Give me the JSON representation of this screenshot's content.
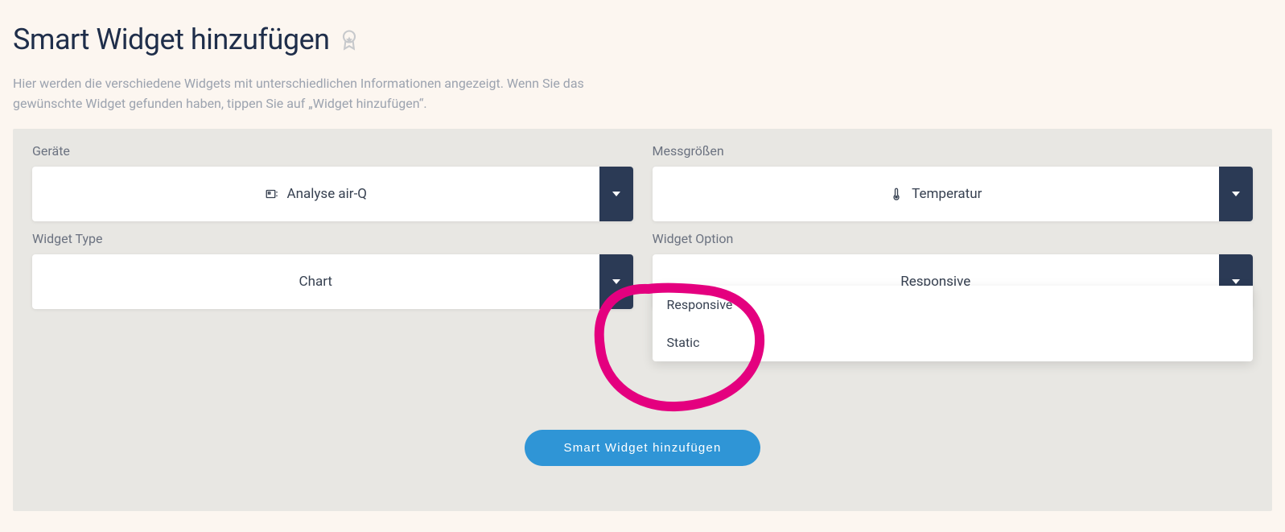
{
  "header": {
    "title": "Smart Widget hinzufügen",
    "subtitle": "Hier werden die verschiedene Widgets mit unterschiedlichen Informationen angezeigt. Wenn Sie das gewünschte Widget gefunden haben, tippen Sie auf „Widget hinzufügen“."
  },
  "fields": {
    "devices": {
      "label": "Geräte",
      "selected": "Analyse air-Q"
    },
    "measures": {
      "label": "Messgrößen",
      "selected": "Temperatur"
    },
    "widget_type": {
      "label": "Widget Type",
      "selected": "Chart"
    },
    "widget_option": {
      "label": "Widget Option",
      "selected": "Responsive",
      "options": [
        "Responsive",
        "Static"
      ]
    }
  },
  "submit_label": "Smart Widget hinzufügen",
  "colors": {
    "page_bg": "#fcf6f0",
    "panel_bg": "#e8e7e3",
    "dark": "#2b3a55",
    "primary": "#2f95d6",
    "annotation": "#e4007f"
  }
}
